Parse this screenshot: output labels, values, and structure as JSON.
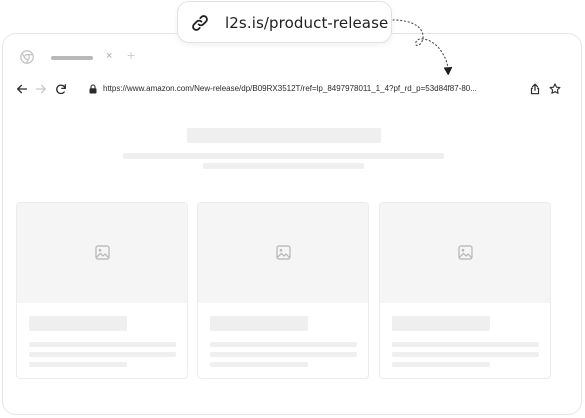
{
  "shortlink": {
    "text": "l2s.is/product-release",
    "icon": "link-icon"
  },
  "browser": {
    "tab": {
      "close_glyph": "×",
      "new_tab_glyph": "+"
    },
    "address_bar": {
      "url": "https://www.amazon.com/New-release/dp/B09RX3512T/ref=lp_8497978011_1_4?pf_rd_p=53d84f87-80..."
    }
  },
  "colors": {
    "skeleton": "#efefef",
    "card_border": "#ececec",
    "frame_border": "#e6e6e6"
  }
}
